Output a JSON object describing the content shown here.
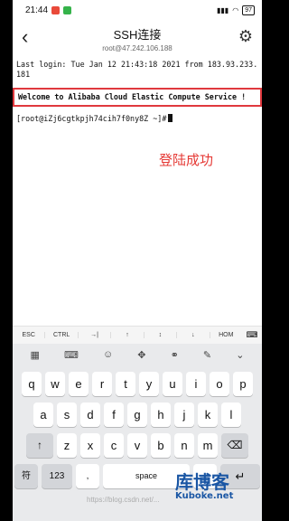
{
  "status_bar": {
    "time": "21:44",
    "battery": "97",
    "signal_text": ""
  },
  "header": {
    "title": "SSH连接",
    "subtitle": "root@47.242.106.188"
  },
  "terminal": {
    "last_login": "Last login: Tue Jan 12 21:43:18 2021 from 183.93.233.181",
    "welcome": "Welcome to Alibaba Cloud Elastic Compute Service !",
    "prompt": "[root@iZj6cgtkpjh74cih7f0ny8Z ~]#"
  },
  "annotation": "登陆成功",
  "extra_keys": [
    "ESC",
    "CTRL",
    "→|",
    "↑",
    "↕",
    "↓",
    "HOM"
  ],
  "toolbar_icons": [
    "grid-icon",
    "keyboard-icon",
    "emoji-icon",
    "move-icon",
    "link-icon",
    "edit-icon",
    "chevron-down-icon"
  ],
  "keyboard": {
    "row1": [
      "q",
      "w",
      "e",
      "r",
      "t",
      "y",
      "u",
      "i",
      "o",
      "p"
    ],
    "row2": [
      "a",
      "s",
      "d",
      "f",
      "g",
      "h",
      "j",
      "k",
      "l"
    ],
    "row3": [
      "z",
      "x",
      "c",
      "v",
      "b",
      "n",
      "m"
    ],
    "shift": "↑",
    "delete": "⌫",
    "lang": "符",
    "numbers": "123",
    "comma": ",",
    "space": "space",
    "period": ".",
    "enter": "↵"
  },
  "watermark": {
    "main": "库博客",
    "sub": "Kuboke.net",
    "blog": "https://blog.csdn.net/..."
  }
}
